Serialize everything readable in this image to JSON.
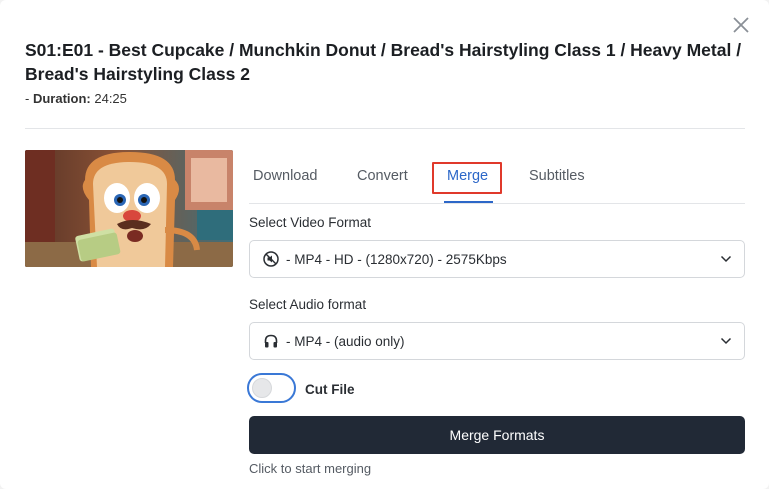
{
  "dialog": {
    "title": "S01:E01 - Best Cupcake / Munchkin Donut / Bread's Hairstyling Class 1 / Heavy Metal / Bread's Hairstyling Class 2",
    "duration_prefix": "- ",
    "duration_label": "Duration:",
    "duration_value": "24:25"
  },
  "tabs": [
    {
      "label": "Download",
      "active": false
    },
    {
      "label": "Convert",
      "active": false
    },
    {
      "label": "Merge",
      "active": true
    },
    {
      "label": "Subtitles",
      "active": false
    }
  ],
  "video_format": {
    "label": "Select Video Format",
    "icon": "muted-speaker-icon",
    "value": "- MP4 - HD - (1280x720) - 2575Kbps"
  },
  "audio_format": {
    "label": "Select Audio format",
    "icon": "headphones-icon",
    "value": "- MP4 - (audio only)"
  },
  "cut_file": {
    "label": "Cut File",
    "enabled": false
  },
  "merge_button": {
    "label": "Merge Formats"
  },
  "hint": "Click to start merging",
  "colors": {
    "accent": "#2c67c8",
    "highlight": "#e0392b",
    "button_bg": "#212936"
  }
}
